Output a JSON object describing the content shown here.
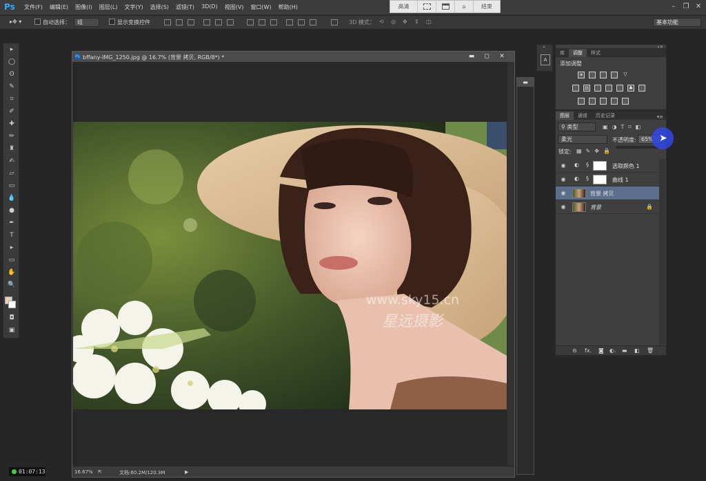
{
  "app": {
    "logo": "Ps",
    "menu": [
      "文件(F)",
      "编辑(E)",
      "图像(I)",
      "图层(L)",
      "文字(Y)",
      "选择(S)",
      "滤镜(T)",
      "3D(D)",
      "视图(V)",
      "窗口(W)",
      "帮助(H)"
    ],
    "recorder": {
      "hd_label": "高清",
      "end_label": "结束"
    }
  },
  "options": {
    "auto_select_label": "自动选择：",
    "auto_select_value": "组",
    "show_transform_label": "显示变换控件",
    "mode_3d_label": "3D 模式：",
    "workspace": "基本功能"
  },
  "document": {
    "title": "bffany-IMG_1250.jpg @ 16.7% (背景 拷贝, RGB/8*) *",
    "zoom": "16.67%",
    "doc_info": "文档:60.2M/120.3M",
    "watermark_url": "www.sky15.cn",
    "watermark_name": "星远摄影"
  },
  "adjust_panel": {
    "tabs": [
      "库",
      "调整",
      "样式"
    ],
    "active_tab": "调整",
    "title": "添加调整"
  },
  "layers_panel": {
    "tabs": [
      "图层",
      "通道",
      "历史记录"
    ],
    "filter_label": "类型",
    "blend_mode": "柔光",
    "opacity_label": "不透明度:",
    "opacity_value": "65%",
    "lock_label": "锁定:",
    "layers": [
      {
        "name": "选取颜色 1",
        "type": "adjustment",
        "selected": false
      },
      {
        "name": "曲线 1",
        "type": "adjustment",
        "selected": false
      },
      {
        "name": "背景 拷贝",
        "type": "image",
        "selected": true
      },
      {
        "name": "背景",
        "type": "image",
        "selected": false,
        "locked": true
      }
    ]
  },
  "recording": {
    "time": "01:07:13"
  }
}
